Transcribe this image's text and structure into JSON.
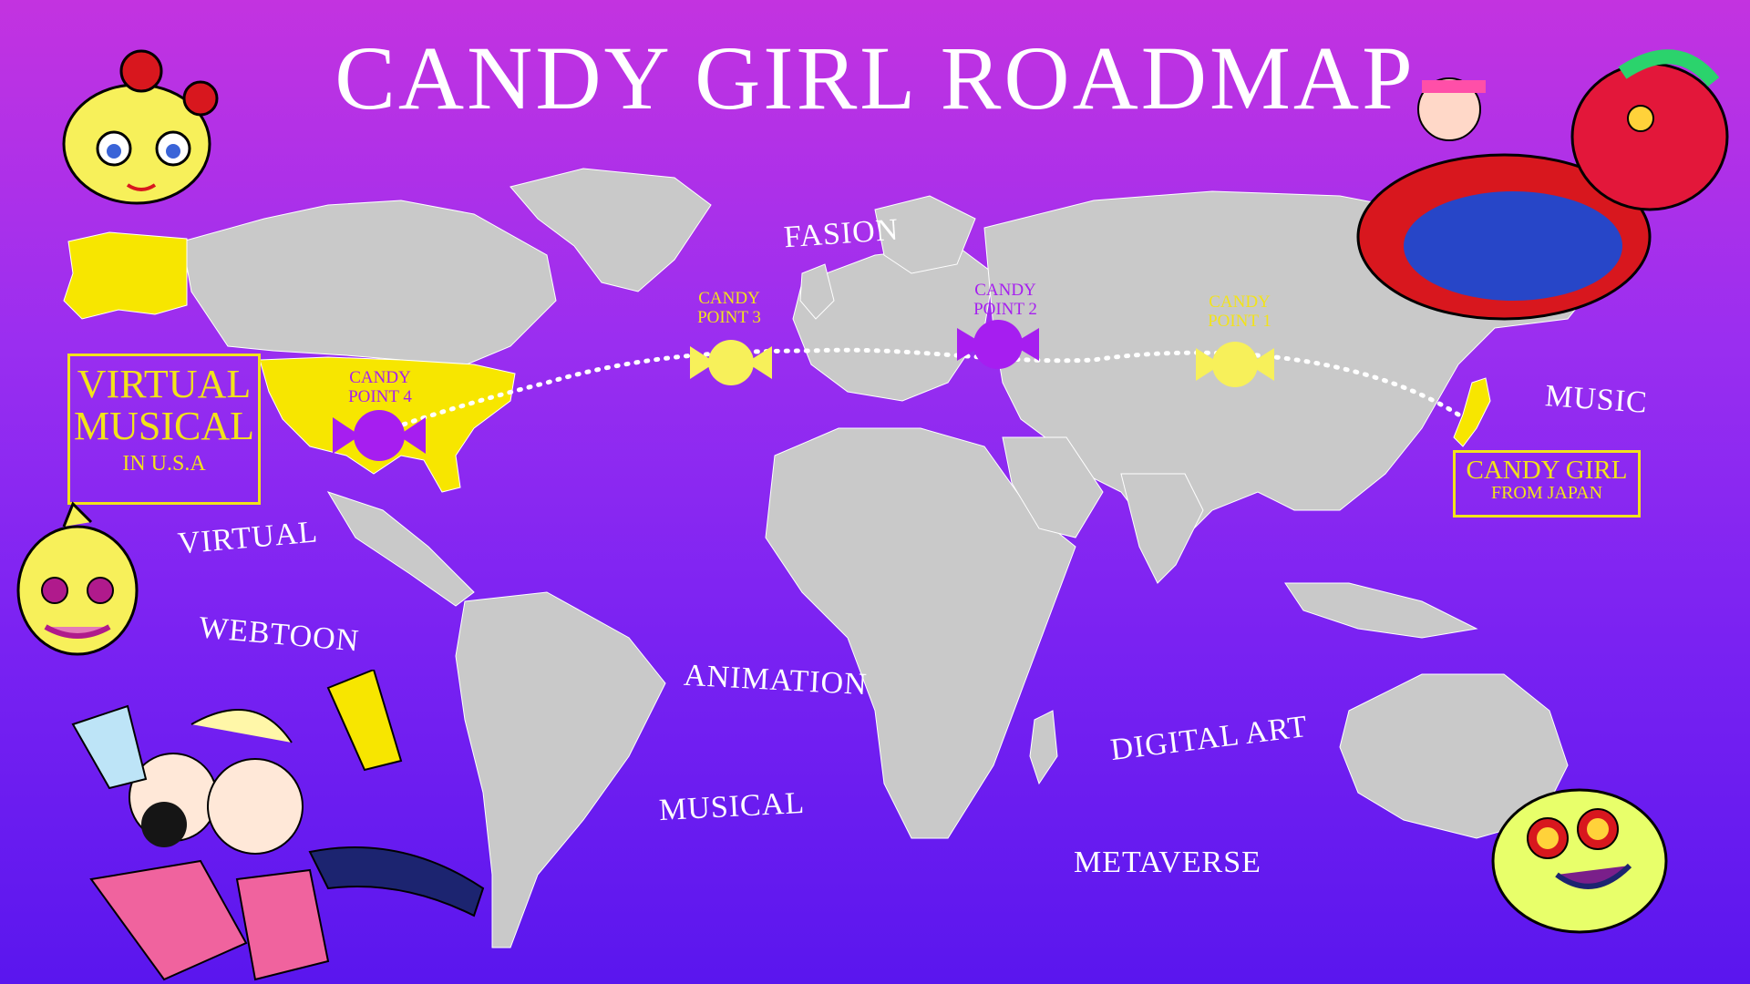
{
  "title": "CANDY GIRL ROADMAP",
  "labels": {
    "fasion": "FASION",
    "music": "MUSIC",
    "virtual": "VIRTUAL",
    "webtoon": "WEBTOON",
    "animation": "ANIMATION",
    "musical": "MUSICAL",
    "digital_art": "DIGITAL  ART",
    "metaverse": "METAVERSE"
  },
  "boxes": {
    "usa": {
      "line1": "VIRTUAL",
      "line2": "MUSICAL",
      "line3": "IN U.S.A"
    },
    "japan": {
      "line1": "CANDY GIRL",
      "line2": "FROM JAPAN"
    }
  },
  "candy_points": [
    {
      "label_top": "CANDY",
      "label_bottom": "POINT 1",
      "color": "#f7f05a"
    },
    {
      "label_top": "CANDY",
      "label_bottom": "POINT 2",
      "color": "#a61ef0"
    },
    {
      "label_top": "CANDY",
      "label_bottom": "POINT 3",
      "color": "#f7f05a"
    },
    {
      "label_top": "CANDY",
      "label_bottom": "POINT 4",
      "color": "#a61ef0"
    }
  ],
  "colors": {
    "land": "#c9c9c9",
    "highlight": "#f7e600",
    "route": "#ffffff",
    "accent_yellow": "#f2e31a"
  }
}
